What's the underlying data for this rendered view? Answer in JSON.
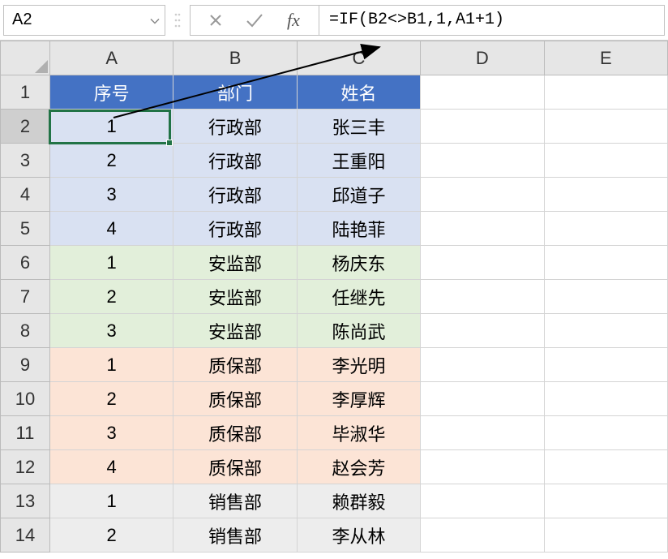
{
  "formula_bar": {
    "name_box": "A2",
    "formula": "=IF(B2<>B1,1,A1+1)",
    "fx_label": "fx"
  },
  "columns": [
    "A",
    "B",
    "C",
    "D",
    "E"
  ],
  "headers": {
    "seq": "序号",
    "dept": "部门",
    "name": "姓名"
  },
  "rows": [
    {
      "n": 1,
      "type": "header"
    },
    {
      "n": 2,
      "grp": "grp1",
      "seq": "1",
      "dept": "行政部",
      "name": "张三丰"
    },
    {
      "n": 3,
      "grp": "grp1",
      "seq": "2",
      "dept": "行政部",
      "name": "王重阳"
    },
    {
      "n": 4,
      "grp": "grp1",
      "seq": "3",
      "dept": "行政部",
      "name": "邱道子"
    },
    {
      "n": 5,
      "grp": "grp1",
      "seq": "4",
      "dept": "行政部",
      "name": "陆艳菲"
    },
    {
      "n": 6,
      "grp": "grp2",
      "seq": "1",
      "dept": "安监部",
      "name": "杨庆东"
    },
    {
      "n": 7,
      "grp": "grp2",
      "seq": "2",
      "dept": "安监部",
      "name": "任继先"
    },
    {
      "n": 8,
      "grp": "grp2",
      "seq": "3",
      "dept": "安监部",
      "name": "陈尚武"
    },
    {
      "n": 9,
      "grp": "grp3",
      "seq": "1",
      "dept": "质保部",
      "name": "李光明"
    },
    {
      "n": 10,
      "grp": "grp3",
      "seq": "2",
      "dept": "质保部",
      "name": "李厚辉"
    },
    {
      "n": 11,
      "grp": "grp3",
      "seq": "3",
      "dept": "质保部",
      "name": "毕淑华"
    },
    {
      "n": 12,
      "grp": "grp3",
      "seq": "4",
      "dept": "质保部",
      "name": "赵会芳"
    },
    {
      "n": 13,
      "grp": "grp4",
      "seq": "1",
      "dept": "销售部",
      "name": "赖群毅"
    },
    {
      "n": 14,
      "grp": "grp4",
      "seq": "2",
      "dept": "销售部",
      "name": "李从林"
    }
  ],
  "selected_cell": "A2"
}
